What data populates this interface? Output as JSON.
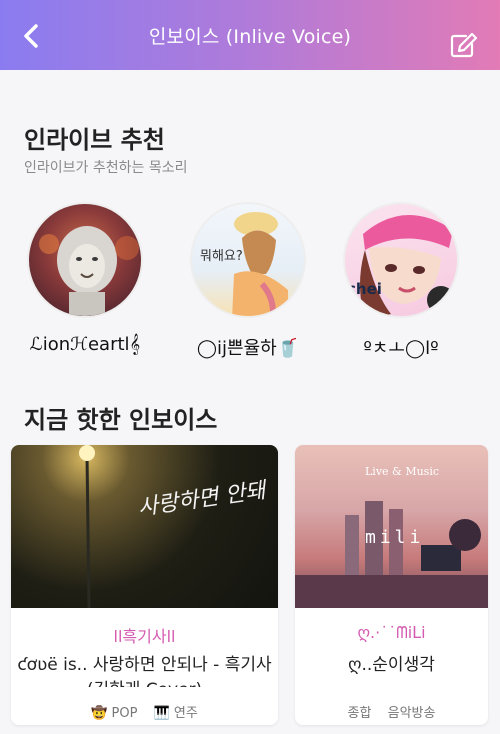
{
  "header": {
    "title": "인보이스 (Inlive Voice)"
  },
  "recommend": {
    "title": "인라이브 추천",
    "subtitle": "인라이브가 추천하는 목소리",
    "items": [
      {
        "name": "ℒionℋeartl𝄞",
        "avatar_text": ""
      },
      {
        "name": "◯ij쁜율하🥤",
        "avatar_text": "뭐해요?"
      },
      {
        "name": "ºㅊㅗ◯lº",
        "avatar_text": "chei"
      }
    ]
  },
  "hot": {
    "title": "지금 핫한 인보이스",
    "cards": [
      {
        "artist": "ll흑기사ll",
        "song_line1": "ƈơʋë is.. 사랑하면 안되나 - 흑기사",
        "song_line2": "(김한래 Cover)",
        "cover_text": "사랑하면 안돼",
        "tags": [
          "🤠 POP",
          "🎹 연주"
        ]
      },
      {
        "artist": "ღ.·˙˙ᗰiᒪi",
        "song_line1": "ღ..순이생각",
        "song_line2": "",
        "cover_text": "Live & Music",
        "cover_text2": "mili",
        "tags": [
          "종합",
          "음악방송"
        ]
      }
    ]
  },
  "colors": {
    "header_gradient_start": "#8a7cf0",
    "header_gradient_end": "#e27bb6",
    "artist_pink": "#d45bb1"
  },
  "icons": {
    "back": "chevron-left-icon",
    "edit": "edit-pen-icon"
  }
}
